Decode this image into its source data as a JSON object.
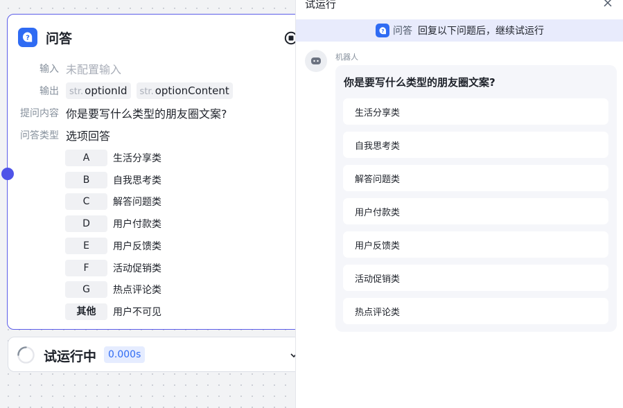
{
  "node": {
    "title": "问答",
    "input_label": "输入",
    "input_value": "未配置输入",
    "output_label": "输出",
    "outputs": [
      {
        "prefix": "str.",
        "name": "optionId"
      },
      {
        "prefix": "str.",
        "name": "optionContent"
      }
    ],
    "prompt_label": "提问内容",
    "prompt_value": "你是要写什么类型的朋友圈文案?",
    "type_label": "问答类型",
    "type_value": "选项回答",
    "options": [
      {
        "key": "A",
        "text": "生活分享类"
      },
      {
        "key": "B",
        "text": "自我思考类"
      },
      {
        "key": "C",
        "text": "解答问题类"
      },
      {
        "key": "D",
        "text": "用户付款类"
      },
      {
        "key": "E",
        "text": "用户反馈类"
      },
      {
        "key": "F",
        "text": "活动促销类"
      },
      {
        "key": "G",
        "text": "热点评论类"
      },
      {
        "key": "其他",
        "text": "用户不可见"
      }
    ]
  },
  "run_status": {
    "label": "试运行中",
    "time": "0.000s"
  },
  "panel": {
    "title": "试运行",
    "banner_node": "问答",
    "banner_text": "回复以下问题后，继续试运行",
    "bot_name": "机器人",
    "question": "你是要写什么类型的朋友圈文案?",
    "choices": [
      "生活分享类",
      "自我思考类",
      "解答问题类",
      "用户付款类",
      "用户反馈类",
      "活动促销类",
      "热点评论类"
    ]
  },
  "colors": {
    "accent": "#2f6bf3",
    "node_border": "#5b5ce8",
    "port": "#4f54e8",
    "banner_bg": "#e8ebfc"
  }
}
